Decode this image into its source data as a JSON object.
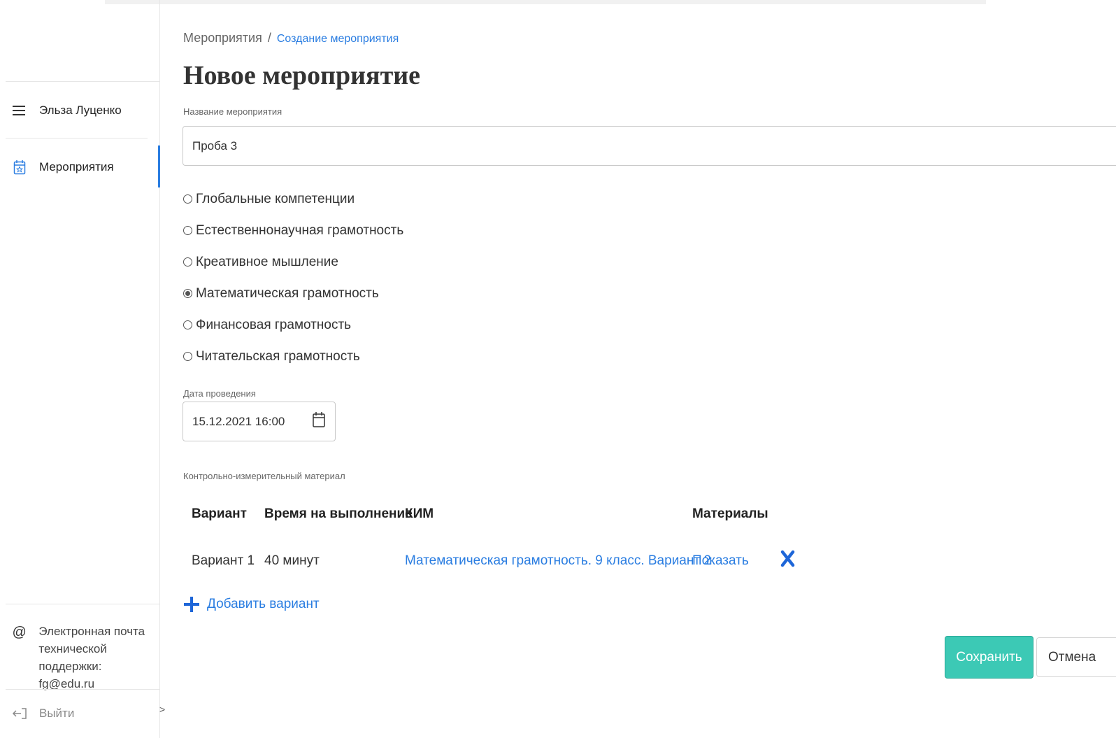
{
  "sidebar": {
    "user_name": "Эльза Луценко",
    "nav_events": "Мероприятия",
    "support_line1": "Электронная почта",
    "support_line2": "технической",
    "support_line3": "поддержки: fg@edu.ru",
    "logout": "Выйти",
    "collapse_symbol": ">"
  },
  "breadcrumb": {
    "parent": "Мероприятия",
    "separator": "/",
    "current": "Создание мероприятия"
  },
  "page_title": "Новое мероприятие",
  "event_name": {
    "label": "Название мероприятия",
    "value": "Проба 3"
  },
  "competencies": {
    "options": [
      {
        "label": "Глобальные компетенции",
        "selected": false
      },
      {
        "label": "Естественнонаучная грамотность",
        "selected": false
      },
      {
        "label": "Креативное мышление",
        "selected": false
      },
      {
        "label": "Математическая грамотность",
        "selected": true
      },
      {
        "label": "Финансовая грамотность",
        "selected": false
      },
      {
        "label": "Читательская грамотность",
        "selected": false
      }
    ]
  },
  "date": {
    "label": "Дата проведения",
    "value": "15.12.2021 16:00"
  },
  "kim": {
    "label": "Контрольно-измерительный материал",
    "headers": {
      "variant": "Вариант",
      "time": "Время на выполнение",
      "kim": "КИМ",
      "materials": "Материалы"
    },
    "rows": [
      {
        "variant": "Вариант 1",
        "time": "40 минут",
        "kim": "Математическая грамотность. 9 класс. Вариант 2",
        "materials": "Показать"
      }
    ],
    "add_variant": "Добавить вариант"
  },
  "actions": {
    "save": "Сохранить",
    "cancel": "Отмена"
  },
  "colors": {
    "accent": "#2a7de1",
    "save_button": "#3cc9b5"
  }
}
